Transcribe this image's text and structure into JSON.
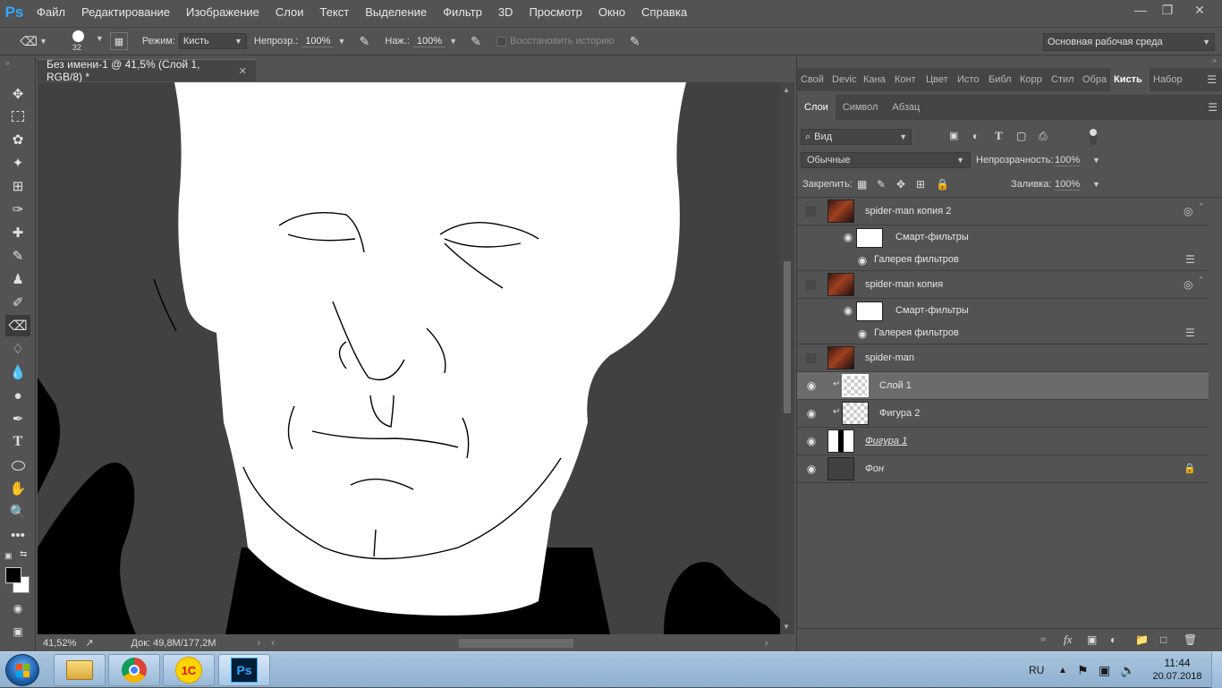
{
  "app": {
    "logo": "Ps"
  },
  "menu": [
    "Файл",
    "Редактирование",
    "Изображение",
    "Слои",
    "Текст",
    "Выделение",
    "Фильтр",
    "3D",
    "Просмотр",
    "Окно",
    "Справка"
  ],
  "options": {
    "brush_size": "32",
    "mode_label": "Режим:",
    "mode_value": "Кисть",
    "opacity_label": "Непрозр.:",
    "opacity_value": "100%",
    "pressure_label": "Наж.:",
    "pressure_value": "100%",
    "restore_history": "Восстановить историю",
    "workspace": "Основная рабочая среда"
  },
  "document": {
    "tab_title": "Без имени-1 @ 41,5% (Слой 1, RGB/8) *",
    "zoom": "41,52%",
    "doc_size": "Док: 49,8M/177,2M"
  },
  "panel_tabs": [
    "Свой",
    "Devic",
    "Кана",
    "Конт",
    "Цвет",
    "Исто",
    "Библ",
    "Корр",
    "Стил",
    "Обра",
    "Кисть",
    "Набор"
  ],
  "layers_tabs": [
    "Слои",
    "Символ",
    "Абзац"
  ],
  "layers": {
    "filter_kind": "Вид",
    "blend_mode": "Обычные",
    "opacity_label": "Непрозрачность:",
    "opacity_value": "100%",
    "lock_label": "Закрепить:",
    "fill_label": "Заливка:",
    "fill_value": "100%",
    "items": [
      {
        "name": "spider-man копия 2",
        "smart_filters": "Смарт-фильтры",
        "filter_gallery": "Галерея фильтров"
      },
      {
        "name": "spider-man копия",
        "smart_filters": "Смарт-фильтры",
        "filter_gallery": "Галерея фильтров"
      },
      {
        "name": "spider-man"
      },
      {
        "name": "Слой 1"
      },
      {
        "name": "Фигура 2"
      },
      {
        "name": "Фигура 1"
      },
      {
        "name": "Фон"
      }
    ]
  },
  "taskbar": {
    "lang": "RU",
    "time": "11:44",
    "date": "20.07.2018",
    "apps": [
      "explorer",
      "chrome",
      "1c",
      "photoshop"
    ],
    "ps_label": "Ps",
    "onec_label": "1С"
  },
  "colors": {
    "accent": "#31a8ff",
    "ui_bg": "#535353",
    "canvas_bg": "#414141"
  }
}
